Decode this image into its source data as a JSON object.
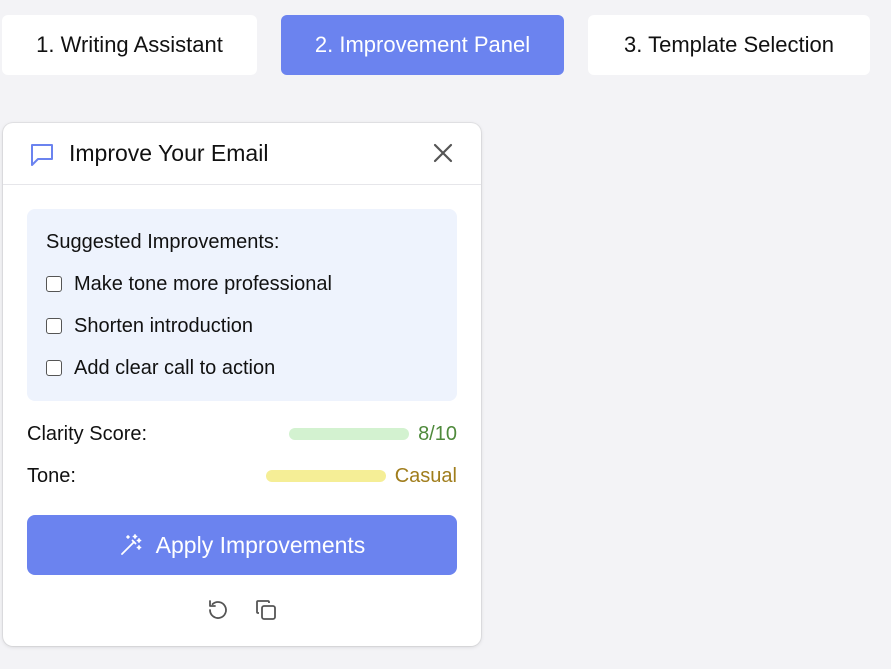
{
  "tabs": [
    {
      "label": "1. Writing Assistant",
      "active": false
    },
    {
      "label": "2. Improvement Panel",
      "active": true
    },
    {
      "label": "3. Template Selection",
      "active": false
    }
  ],
  "panel": {
    "title": "Improve Your Email",
    "header_icon": "chat-bubble-icon",
    "close_icon": "close-icon",
    "suggestions": {
      "title": "Suggested Improvements:",
      "items": [
        {
          "label": "Make tone more professional",
          "checked": false
        },
        {
          "label": "Shorten introduction",
          "checked": false
        },
        {
          "label": "Add clear call to action",
          "checked": false
        }
      ]
    },
    "metrics": {
      "clarity": {
        "label": "Clarity Score:",
        "value": "8/10",
        "bar_color": "#d3f2d0",
        "value_color": "#4f8a3c"
      },
      "tone": {
        "label": "Tone:",
        "value": "Casual",
        "bar_color": "#f5ee96",
        "value_color": "#a07d1c"
      }
    },
    "apply_button": {
      "label": "Apply Improvements",
      "icon": "magic-wand-icon"
    },
    "footer_icons": [
      "undo-icon",
      "copy-icon"
    ]
  },
  "colors": {
    "accent": "#6b83ef",
    "background": "#f3f3f6",
    "suggestion_box": "#eef3fd"
  }
}
